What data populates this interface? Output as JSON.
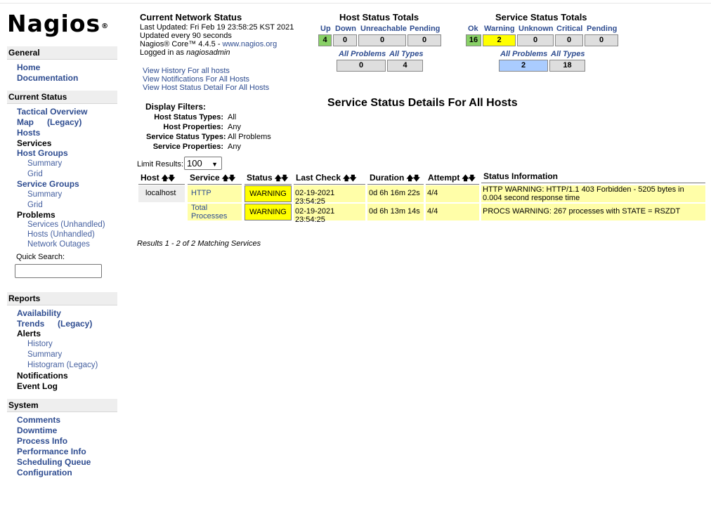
{
  "logo": {
    "text": "Nagios",
    "reg": "®"
  },
  "sidebar": {
    "general": {
      "heading": "General",
      "items": [
        "Home",
        "Documentation"
      ]
    },
    "current_status": {
      "heading": "Current Status",
      "tactical": "Tactical Overview",
      "map": "Map",
      "map_legacy": "(Legacy)",
      "hosts": "Hosts",
      "services": "Services",
      "host_groups": "Host Groups",
      "hg_summary": "Summary",
      "hg_grid": "Grid",
      "service_groups": "Service Groups",
      "sg_summary": "Summary",
      "sg_grid": "Grid",
      "problems": "Problems",
      "svc_unhandled": "Services (Unhandled)",
      "hosts_unhandled": "Hosts (Unhandled)",
      "outages": "Network Outages",
      "quick_search": "Quick Search:"
    },
    "reports": {
      "heading": "Reports",
      "availability": "Availability",
      "trends": "Trends",
      "trends_legacy": "(Legacy)",
      "alerts": "Alerts",
      "history": "History",
      "summary": "Summary",
      "histogram": "Histogram (Legacy)",
      "notifications": "Notifications",
      "event_log": "Event Log"
    },
    "system": {
      "heading": "System",
      "comments": "Comments",
      "downtime": "Downtime",
      "process_info": "Process Info",
      "performance_info": "Performance Info",
      "scheduling_queue": "Scheduling Queue",
      "configuration": "Configuration"
    }
  },
  "status": {
    "title": "Current Network Status",
    "last_updated": "Last Updated: Fri Feb 19 23:58:25 KST 2021",
    "interval": "Updated every 90 seconds",
    "version_prefix": "Nagios® Core™ 4.4.5 - ",
    "version_link": "www.nagios.org",
    "logged_prefix": "Logged in as ",
    "user": "nagiosadmin",
    "links": [
      "View History For all hosts",
      "View Notifications For All Hosts",
      "View Host Status Detail For All Hosts"
    ]
  },
  "host_totals": {
    "title": "Host Status Totals",
    "labels": {
      "up": "Up",
      "down": "Down",
      "unreachable": "Unreachable",
      "pending": "Pending"
    },
    "values": {
      "up": "4",
      "down": "0",
      "unreachable": "0",
      "pending": "0"
    },
    "all_problems_label": "All Problems",
    "all_types_label": "All Types",
    "all_problems": "0",
    "all_types": "4"
  },
  "service_totals": {
    "title": "Service Status Totals",
    "labels": {
      "ok": "Ok",
      "warning": "Warning",
      "unknown": "Unknown",
      "critical": "Critical",
      "pending": "Pending"
    },
    "values": {
      "ok": "16",
      "warning": "2",
      "unknown": "0",
      "critical": "0",
      "pending": "0"
    },
    "all_problems_label": "All Problems",
    "all_types_label": "All Types",
    "all_problems": "2",
    "all_types": "18"
  },
  "filters": {
    "title": "Display Filters:",
    "host_status_types_label": "Host Status Types:",
    "host_status_types": "All",
    "host_properties_label": "Host Properties:",
    "host_properties": "Any",
    "service_status_types_label": "Service Status Types:",
    "service_status_types": "All Problems",
    "service_properties_label": "Service Properties:",
    "service_properties": "Any"
  },
  "main_title": "Service Status Details For All Hosts",
  "limit": {
    "label": "Limit Results:",
    "value": "100"
  },
  "table": {
    "headers": {
      "host": "Host",
      "service": "Service",
      "status": "Status",
      "last_check": "Last Check",
      "duration": "Duration",
      "attempt": "Attempt",
      "info": "Status Information"
    },
    "rows": [
      {
        "host": "localhost",
        "service": "HTTP",
        "status": "WARNING",
        "last_check": "02-19-2021 23:54:25",
        "duration": "0d 6h 16m 22s",
        "attempt": "4/4",
        "info": "HTTP WARNING: HTTP/1.1 403 Forbidden - 5205 bytes in 0.004 second response time"
      },
      {
        "host": "",
        "service": "Total Processes",
        "status": "WARNING",
        "last_check": "02-19-2021 23:54:25",
        "duration": "0d 6h 13m 14s",
        "attempt": "4/4",
        "info": "PROCS WARNING: 267 processes with STATE = RSZDT"
      }
    ],
    "results": "Results 1 - 2 of 2 Matching Services"
  },
  "colors": {
    "link": "#2e4c90",
    "ok_green": "#88d066",
    "warning_yellow": "#ffff00",
    "problem_blue": "#aaccff",
    "row_yellow": "#fffea8"
  }
}
